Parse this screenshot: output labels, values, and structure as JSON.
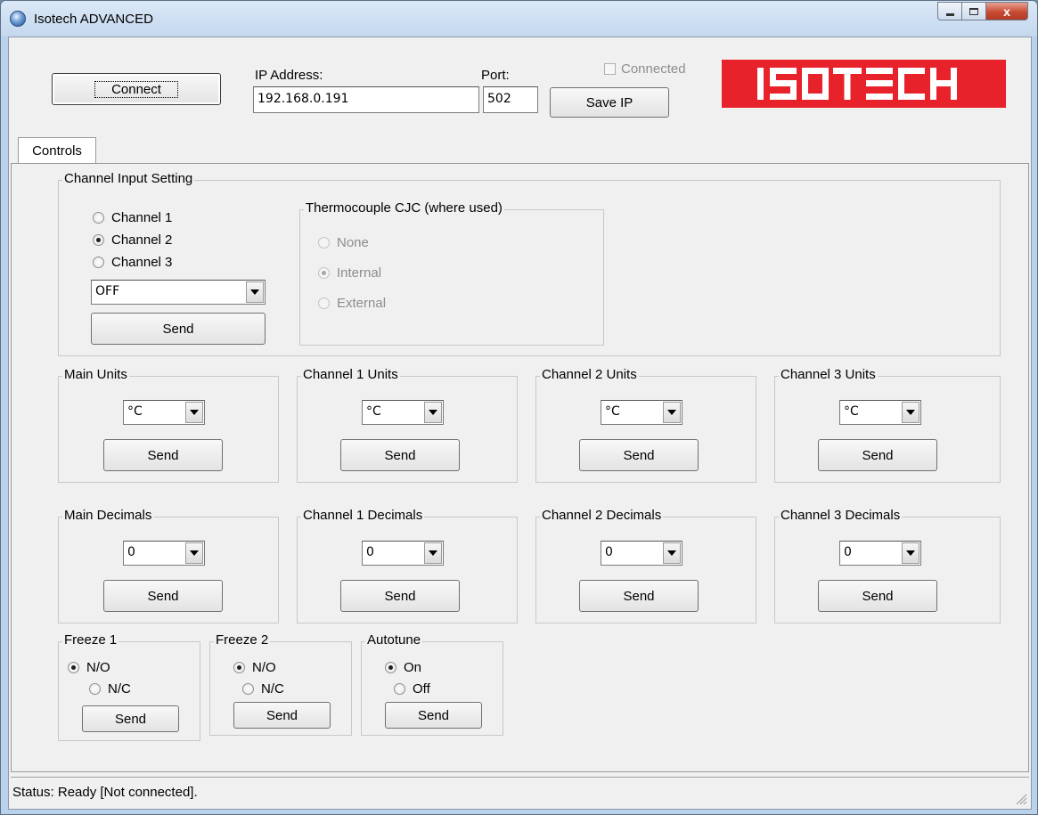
{
  "window": {
    "title": "Isotech ADVANCED",
    "close_glyph": "x"
  },
  "connection": {
    "connect_label": "Connect",
    "ip_label": "IP Address:",
    "ip_value": "192.168.0.191",
    "port_label": "Port:",
    "port_value": "502",
    "save_ip_label": "Save IP",
    "connected_label": "Connected",
    "connected_checked": false
  },
  "logo": {
    "text": "ISOTECH",
    "color": "#e8222a"
  },
  "tabs": [
    {
      "label": "Controls",
      "active": true
    }
  ],
  "channel_input": {
    "title": "Channel Input Setting",
    "channels": [
      {
        "label": "Channel 1",
        "selected": false
      },
      {
        "label": "Channel 2",
        "selected": true
      },
      {
        "label": "Channel 3",
        "selected": false
      }
    ],
    "input_type": "OFF",
    "send_label": "Send",
    "cjc": {
      "title": "Thermocouple CJC (where used)",
      "options": [
        {
          "label": "None",
          "selected": false
        },
        {
          "label": "Internal",
          "selected": true
        },
        {
          "label": "External",
          "selected": false
        }
      ],
      "enabled": false
    }
  },
  "units": [
    {
      "title": "Main Units",
      "value": "°C",
      "send_label": "Send"
    },
    {
      "title": "Channel 1 Units",
      "value": "°C",
      "send_label": "Send"
    },
    {
      "title": "Channel 2 Units",
      "value": "°C",
      "send_label": "Send"
    },
    {
      "title": "Channel 3 Units",
      "value": "°C",
      "send_label": "Send"
    }
  ],
  "decimals": [
    {
      "title": "Main Decimals",
      "value": "0",
      "send_label": "Send"
    },
    {
      "title": "Channel 1 Decimals",
      "value": "0",
      "send_label": "Send"
    },
    {
      "title": "Channel 2 Decimals",
      "value": "0",
      "send_label": "Send"
    },
    {
      "title": "Channel 3 Decimals",
      "value": "0",
      "send_label": "Send"
    }
  ],
  "toggles": [
    {
      "title": "Freeze 1",
      "options": [
        {
          "label": "N/O",
          "selected": true
        },
        {
          "label": "N/C",
          "selected": false
        }
      ],
      "send_label": "Send"
    },
    {
      "title": "Freeze 2",
      "options": [
        {
          "label": "N/O",
          "selected": true
        },
        {
          "label": "N/C",
          "selected": false
        }
      ],
      "send_label": "Send"
    },
    {
      "title": "Autotune",
      "options": [
        {
          "label": "On",
          "selected": true
        },
        {
          "label": "Off",
          "selected": false
        }
      ],
      "send_label": "Send"
    }
  ],
  "status": {
    "text": "Status: Ready [Not connected]."
  }
}
